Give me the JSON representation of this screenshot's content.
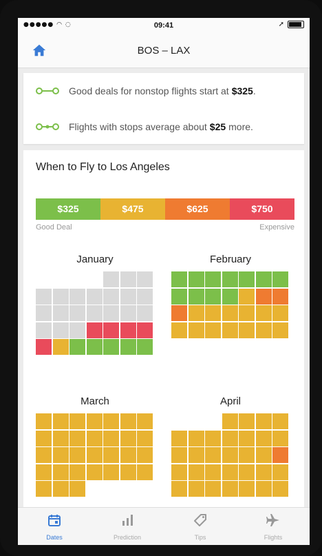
{
  "status_bar": {
    "signal": "●●●●● ◠ ◌",
    "time": "09:41",
    "location_arrow": "➚"
  },
  "nav": {
    "title": "BOS – LAX",
    "home_icon": "home-icon"
  },
  "deals": [
    {
      "prefix": "Good deals for nonstop flights start at",
      "amount": "$325",
      "suffix": ".",
      "icon": "nonstop-route-icon"
    },
    {
      "prefix": "Flights with stops average about",
      "amount": "$25",
      "suffix": "more.",
      "icon": "stops-route-icon"
    }
  ],
  "when_to_fly": {
    "title": "When to Fly to Los Angeles",
    "price_levels": [
      {
        "label": "$325",
        "color": "#7cbf4a"
      },
      {
        "label": "$475",
        "color": "#e8b332"
      },
      {
        "label": "$625",
        "color": "#ef7b31"
      },
      {
        "label": "$750",
        "color": "#e94b5b"
      }
    ],
    "low_label": "Good Deal",
    "high_label": "Expensive"
  },
  "colors": {
    "none": "#d9d9d9",
    "green": "#7cbf4a",
    "yellow": "#e8b332",
    "orange": "#ef7b31",
    "red": "#e94b5b",
    "accent": "#3a7bd5"
  },
  "months": [
    {
      "name": "January",
      "cells": [
        "_",
        "_",
        "_",
        "_",
        "x",
        "x",
        "x",
        "x",
        "x",
        "x",
        "x",
        "x",
        "x",
        "x",
        "x",
        "x",
        "x",
        "x",
        "x",
        "x",
        "x",
        "x",
        "x",
        "x",
        "r",
        "r",
        "r",
        "r",
        "r",
        "y",
        "g",
        "g",
        "g",
        "g",
        "g"
      ]
    },
    {
      "name": "February",
      "cells": [
        "g",
        "g",
        "g",
        "g",
        "g",
        "g",
        "g",
        "g",
        "g",
        "g",
        "g",
        "y",
        "o",
        "o",
        "o",
        "y",
        "y",
        "y",
        "y",
        "y",
        "y",
        "y",
        "y",
        "y",
        "y",
        "y",
        "y",
        "y"
      ]
    },
    {
      "name": "March",
      "cells": [
        "y",
        "y",
        "y",
        "y",
        "y",
        "y",
        "y",
        "y",
        "y",
        "y",
        "y",
        "y",
        "y",
        "y",
        "y",
        "y",
        "y",
        "y",
        "y",
        "y",
        "y",
        "y",
        "y",
        "y",
        "y",
        "y",
        "y",
        "y",
        "y",
        "y",
        "y",
        "_",
        "_",
        "_",
        "_"
      ]
    },
    {
      "name": "April",
      "cells": [
        "_",
        "_",
        "_",
        "y",
        "y",
        "y",
        "y",
        "y",
        "y",
        "y",
        "y",
        "y",
        "y",
        "y",
        "y",
        "y",
        "y",
        "y",
        "y",
        "y",
        "o",
        "y",
        "y",
        "y",
        "y",
        "y",
        "y",
        "y",
        "y",
        "y",
        "y",
        "y",
        "y",
        "y",
        "y"
      ]
    }
  ],
  "tabs": [
    {
      "label": "Dates",
      "icon": "calendar-icon",
      "active": true
    },
    {
      "label": "Prediction",
      "icon": "bar-chart-icon",
      "active": false
    },
    {
      "label": "Tips",
      "icon": "tag-icon",
      "active": false
    },
    {
      "label": "Flights",
      "icon": "airplane-icon",
      "active": false
    }
  ]
}
